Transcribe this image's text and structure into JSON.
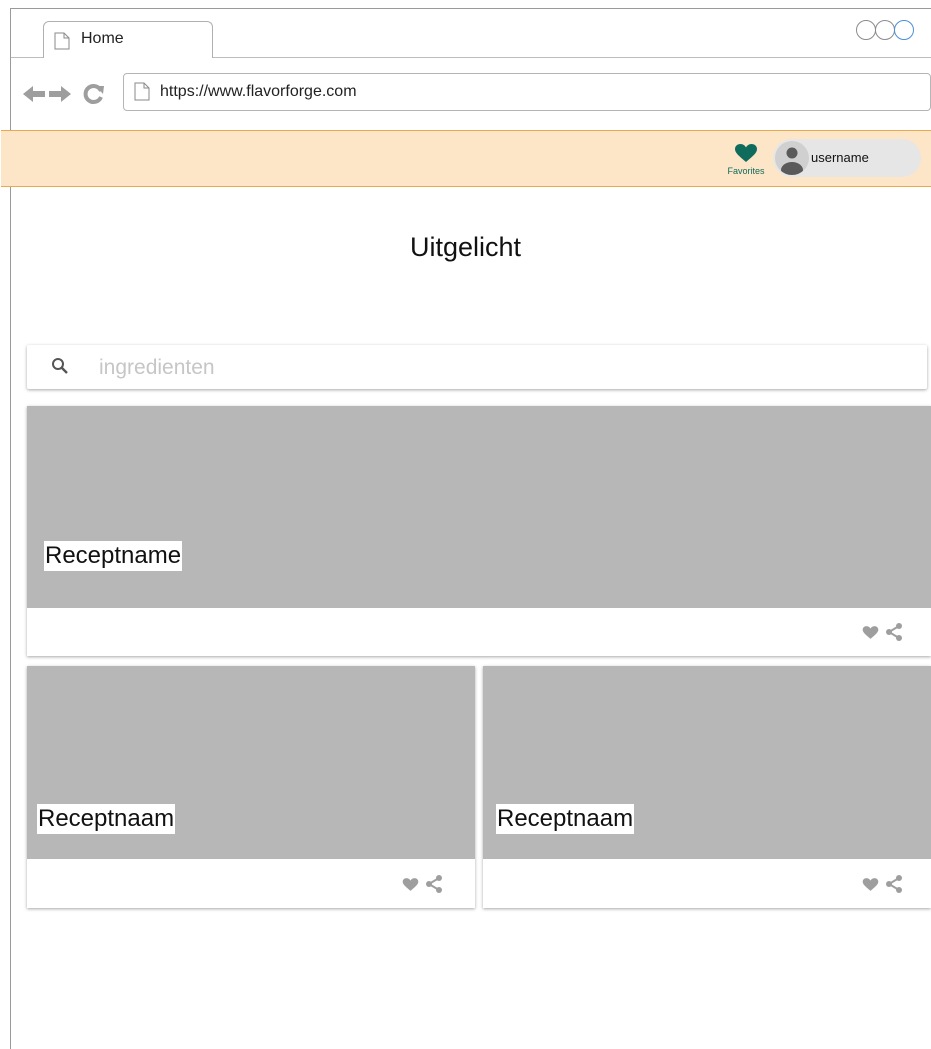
{
  "browser": {
    "tab_label": "Home",
    "url": "https://www.flavorforge.com"
  },
  "header": {
    "favorites_label": "Favorites",
    "username": "username",
    "accent_color": "#0f6b5c",
    "band_color": "#fde5c8"
  },
  "main": {
    "title": "Uitgelicht",
    "search_placeholder": "ingredienten",
    "featured_card": {
      "name": "Receptname"
    },
    "cards": [
      {
        "name": "Receptnaam"
      },
      {
        "name": "Receptnaam"
      }
    ]
  }
}
